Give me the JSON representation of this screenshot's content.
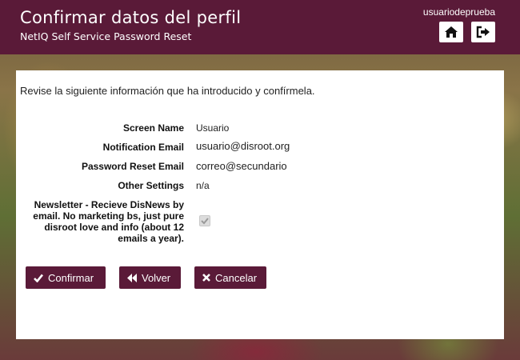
{
  "header": {
    "title": "Confirmar datos del perfil",
    "subtitle": "NetIQ Self Service Password Reset",
    "username": "usuariodeprueba",
    "home_icon": "home-icon",
    "logout_icon": "logout-icon"
  },
  "main": {
    "intro": "Revise la siguiente información que ha introducido y confírmela.",
    "fields": [
      {
        "label": "Screen Name",
        "value": "Usuario"
      },
      {
        "label": "Notification Email",
        "value": "usuario@disroot.org"
      },
      {
        "label": "Password Reset Email",
        "value": "correo@secundario"
      },
      {
        "label": "Other Settings",
        "value": "n/a"
      },
      {
        "label": "Newsletter - Recieve DisNews by email. No marketing bs, just pure disroot love and info (about 12 emails a year).",
        "checked": true
      }
    ]
  },
  "buttons": {
    "confirm": "Confirmar",
    "back": "Volver",
    "cancel": "Cancelar"
  },
  "colors": {
    "brand": "#5a1a38",
    "panel": "#ffffff"
  }
}
